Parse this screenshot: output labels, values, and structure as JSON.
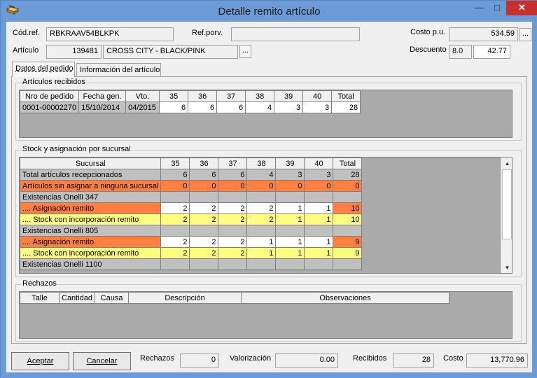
{
  "window": {
    "title": "Detalle remito artículo"
  },
  "header": {
    "codref_label": "Cód.ref.",
    "codref_value": "RBKRAAV54BLKPK",
    "refporv_label": "Ref.porv.",
    "refporv_value": "",
    "costo_label": "Costo p.u.",
    "costo_value": "534.59",
    "articulo_label": "Artículo",
    "articulo_code": "139481",
    "articulo_desc": "CROSS CITY - BLACK/PINK",
    "descuento_label": "Descuento",
    "descuento_pct": "8.0",
    "descuento_value": "42.77",
    "ellipsis": "..."
  },
  "tabs": [
    {
      "label": "Datos del pedido",
      "active": true
    },
    {
      "label": "Información del artículo",
      "active": false
    }
  ],
  "recibidos": {
    "title": "Artículos recibidos",
    "columns": [
      "Nro de pedido",
      "Fecha gen.",
      "Vto.",
      "35",
      "36",
      "37",
      "38",
      "39",
      "40",
      "Total"
    ],
    "rows": [
      {
        "cells": [
          "0001-00002270",
          "15/10/2014",
          "04/2015",
          "6",
          "6",
          "6",
          "4",
          "3",
          "3",
          "28"
        ]
      }
    ]
  },
  "stock": {
    "title": "Stock y asignación por sucursal",
    "columns": [
      "Sucursal",
      "35",
      "36",
      "37",
      "38",
      "39",
      "40",
      "Total"
    ],
    "rows": [
      {
        "style": "gray",
        "cells": [
          "Total artículos recepcionados",
          "6",
          "6",
          "6",
          "4",
          "3",
          "3",
          "28"
        ]
      },
      {
        "style": "orange",
        "cells": [
          "Artículos sin asignar a ninguna sucursal",
          "0",
          "0",
          "0",
          "0",
          "0",
          "0",
          "0"
        ]
      },
      {
        "style": "gray",
        "cells": [
          "Existencias Onelli 347",
          "",
          "",
          "",
          "",
          "",
          "",
          ""
        ]
      },
      {
        "style": "orange-white",
        "cells": [
          ".... Asignación remito",
          "2",
          "2",
          "2",
          "2",
          "1",
          "1",
          "10"
        ]
      },
      {
        "style": "yellow",
        "cells": [
          ".... Stock con incorporación remito",
          "2",
          "2",
          "2",
          "2",
          "1",
          "1",
          "10"
        ]
      },
      {
        "style": "gray",
        "cells": [
          "Existencias Onelli 805",
          "",
          "",
          "",
          "",
          "",
          "",
          ""
        ]
      },
      {
        "style": "orange-white",
        "cells": [
          ".... Asignación remito",
          "2",
          "2",
          "2",
          "1",
          "1",
          "1",
          "9"
        ]
      },
      {
        "style": "yellow",
        "cells": [
          ".... Stock con incorporación remito",
          "2",
          "2",
          "2",
          "1",
          "1",
          "1",
          "9"
        ]
      },
      {
        "style": "gray",
        "cells": [
          "Existencias Onelli 1100",
          "",
          "",
          "",
          "",
          "",
          "",
          ""
        ]
      }
    ],
    "scroll_position": 0.0
  },
  "rechazos": {
    "title": "Rechazos",
    "columns": [
      "Talle",
      "Cantidad",
      "Causa",
      "Descripción",
      "Observaciones"
    ]
  },
  "footer": {
    "aceptar": "Aceptar",
    "cancelar": "Cancelar",
    "rechazos_label": "Rechazos",
    "rechazos_value": "0",
    "valorizacion_label": "Valorización",
    "valorizacion_value": "0.00",
    "recibidos_label": "Recibidos",
    "recibidos_value": "28",
    "costo_label": "Costo",
    "costo_value": "13,770.96"
  },
  "colors": {
    "orange": "#ff8040",
    "yellow": "#ffff80",
    "gray": "#c0c0c0",
    "titlebar": "#6b9bd6",
    "close": "#c7312d"
  },
  "icons": {
    "app": "folder-pencil-icon",
    "minimize": "minimize-icon",
    "maximize": "maximize-icon",
    "close": "close-icon"
  }
}
